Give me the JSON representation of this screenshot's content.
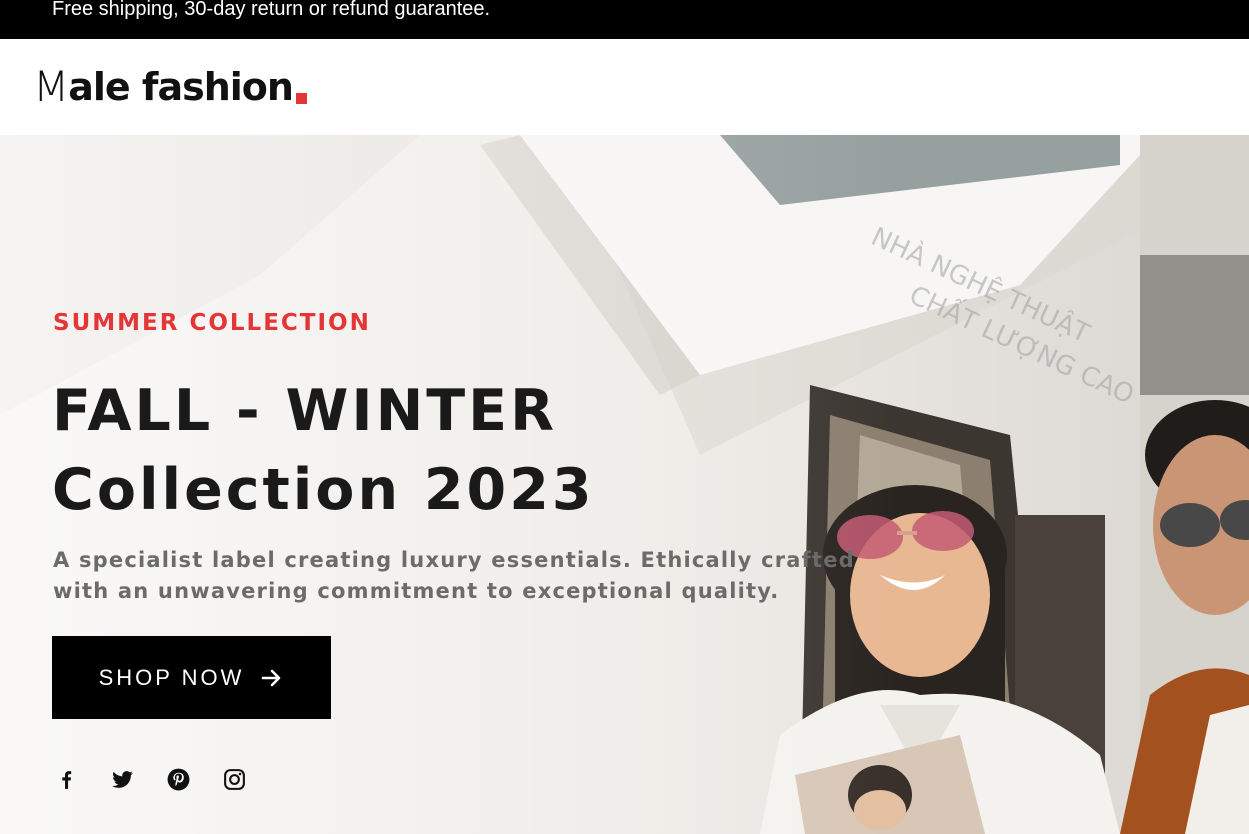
{
  "topbar": {
    "text": "Free shipping, 30-day return or refund guarantee."
  },
  "header": {
    "logo": {
      "initial": "M",
      "rest": "ale fashion",
      "accent_color": "#e53637"
    }
  },
  "hero": {
    "eyebrow": "SUMMER COLLECTION",
    "headline": [
      "FALL - WINTER",
      "Collection 2023"
    ],
    "description": "A specialist label creating luxury essentials. Ethically crafted with an unwavering commitment to exceptional quality.",
    "cta": {
      "label": "SHOP NOW",
      "icon": "arrow-right-icon"
    },
    "social": [
      {
        "name": "facebook",
        "icon": "facebook-icon"
      },
      {
        "name": "twitter",
        "icon": "twitter-icon"
      },
      {
        "name": "pinterest",
        "icon": "pinterest-icon"
      },
      {
        "name": "instagram",
        "icon": "instagram-icon"
      }
    ]
  },
  "colors": {
    "accent": "#e53637",
    "dark": "#000000",
    "headline": "#1a1a1a",
    "muted": "#6b6b6b"
  }
}
